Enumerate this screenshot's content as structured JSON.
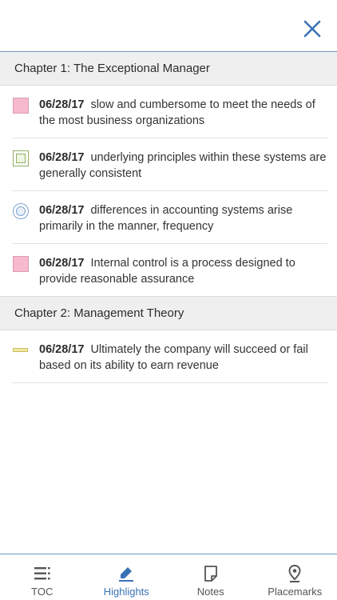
{
  "header": {
    "close_icon": "close-icon"
  },
  "chapters": [
    {
      "title": "Chapter 1: The Exceptional Manager",
      "items": [
        {
          "date": "06/28/17",
          "text": "slow and cumbersome to meet the needs of the most business organizations",
          "marker": "pink-square",
          "color": "#f7b9cd"
        },
        {
          "date": "06/28/17",
          "text": "underlying principles within these systems are generally consistent",
          "marker": "green-box",
          "color": "#8fae62"
        },
        {
          "date": "06/28/17",
          "text": "differences in accounting systems arise primarily in the manner, frequency",
          "marker": "blue-circle",
          "color": "#7ea4cf"
        },
        {
          "date": "06/28/17",
          "text": "Internal control is a process designed to provide reasonable assurance",
          "marker": "pink-square",
          "color": "#f7b9cd"
        }
      ]
    },
    {
      "title": "Chapter 2: Management Theory",
      "items": [
        {
          "date": "06/28/17",
          "text": "Ultimately the company will succeed or fail based on its ability to earn revenue",
          "marker": "yellow-underline",
          "color": "#f1e9a0"
        }
      ]
    }
  ],
  "tabs": [
    {
      "label": "TOC",
      "icon": "toc-icon",
      "active": false
    },
    {
      "label": "Highlights",
      "icon": "highlighter-icon",
      "active": true
    },
    {
      "label": "Notes",
      "icon": "note-icon",
      "active": false
    },
    {
      "label": "Placemarks",
      "icon": "map-pin-icon",
      "active": false
    }
  ],
  "colors": {
    "accent": "#3a72b6",
    "divider": "#6f95c4",
    "chapter_bg": "#efefef"
  }
}
